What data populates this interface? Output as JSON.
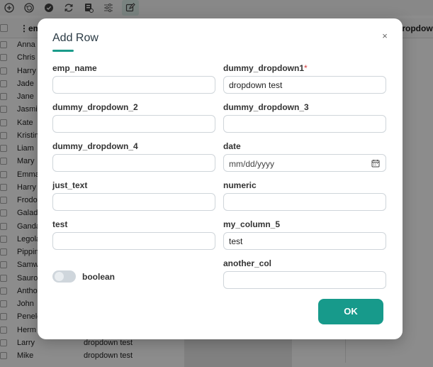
{
  "toolbar": {
    "icons": [
      "add-circle-icon",
      "undo-icon",
      "check-circle-icon",
      "refresh-icon",
      "export-icon",
      "filter-sliders-icon",
      "edit-icon"
    ]
  },
  "grid": {
    "headers": {
      "col1": "em",
      "col_right": "dropdow..."
    },
    "rows": [
      {
        "name": "Anna",
        "dd": ""
      },
      {
        "name": "Chris",
        "dd": ""
      },
      {
        "name": "Harry",
        "dd": ""
      },
      {
        "name": "Jade",
        "dd": ""
      },
      {
        "name": "Jane",
        "dd": ""
      },
      {
        "name": "Jasmin",
        "dd": ""
      },
      {
        "name": "Kate",
        "dd": ""
      },
      {
        "name": "Kristin",
        "dd": ""
      },
      {
        "name": "Liam",
        "dd": ""
      },
      {
        "name": "Mary",
        "dd": ""
      },
      {
        "name": "Emma",
        "dd": ""
      },
      {
        "name": "Harry",
        "dd": ""
      },
      {
        "name": "Frodo",
        "dd": ""
      },
      {
        "name": "Galad",
        "dd": ""
      },
      {
        "name": "Ganda",
        "dd": ""
      },
      {
        "name": "Legola",
        "dd": ""
      },
      {
        "name": "Pippin",
        "dd": ""
      },
      {
        "name": "Samw",
        "dd": ""
      },
      {
        "name": "Sauro",
        "dd": ""
      },
      {
        "name": "Antho",
        "dd": ""
      },
      {
        "name": "John",
        "dd": ""
      },
      {
        "name": "Penele",
        "dd": ""
      },
      {
        "name": "Herm",
        "dd": ""
      },
      {
        "name": "Larry",
        "dd": "dropdown test"
      },
      {
        "name": "Mike",
        "dd": "dropdown test"
      }
    ]
  },
  "modal": {
    "title": "Add Row",
    "close": "×",
    "fields": {
      "emp_name": {
        "label": "emp_name",
        "value": ""
      },
      "dummy_dropdown1": {
        "label": "dummy_dropdown1",
        "required": "*",
        "value": "dropdown test"
      },
      "dummy_dropdown_2": {
        "label": "dummy_dropdown_2",
        "value": ""
      },
      "dummy_dropdown_3": {
        "label": "dummy_dropdown_3",
        "value": ""
      },
      "dummy_dropdown_4": {
        "label": "dummy_dropdown_4",
        "value": ""
      },
      "date": {
        "label": "date",
        "placeholder": "mm/dd/yyyy"
      },
      "just_text": {
        "label": "just_text",
        "value": ""
      },
      "numeric": {
        "label": "numeric",
        "value": ""
      },
      "test": {
        "label": "test",
        "value": ""
      },
      "my_column_5": {
        "label": "my_column_5",
        "value": "test"
      },
      "boolean": {
        "label": "boolean",
        "checked": false
      },
      "another_col": {
        "label": "another_col",
        "value": ""
      }
    },
    "ok_label": "OK"
  },
  "colors": {
    "accent": "#179a8b",
    "required": "#d23b3b"
  }
}
